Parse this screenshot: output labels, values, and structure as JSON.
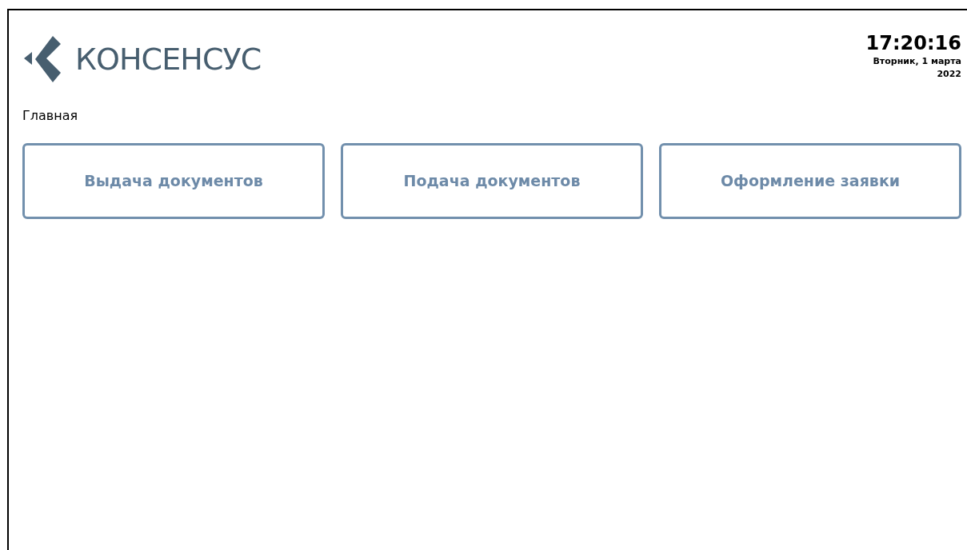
{
  "logo": {
    "text": "КОНСЕНСУС"
  },
  "clock": {
    "time": "17:20:16",
    "date": "Вторник, 1 марта 2022"
  },
  "page_title": "Главная",
  "actions": [
    {
      "label": "Выдача документов"
    },
    {
      "label": "Подача документов"
    },
    {
      "label": "Оформление заявки"
    }
  ]
}
